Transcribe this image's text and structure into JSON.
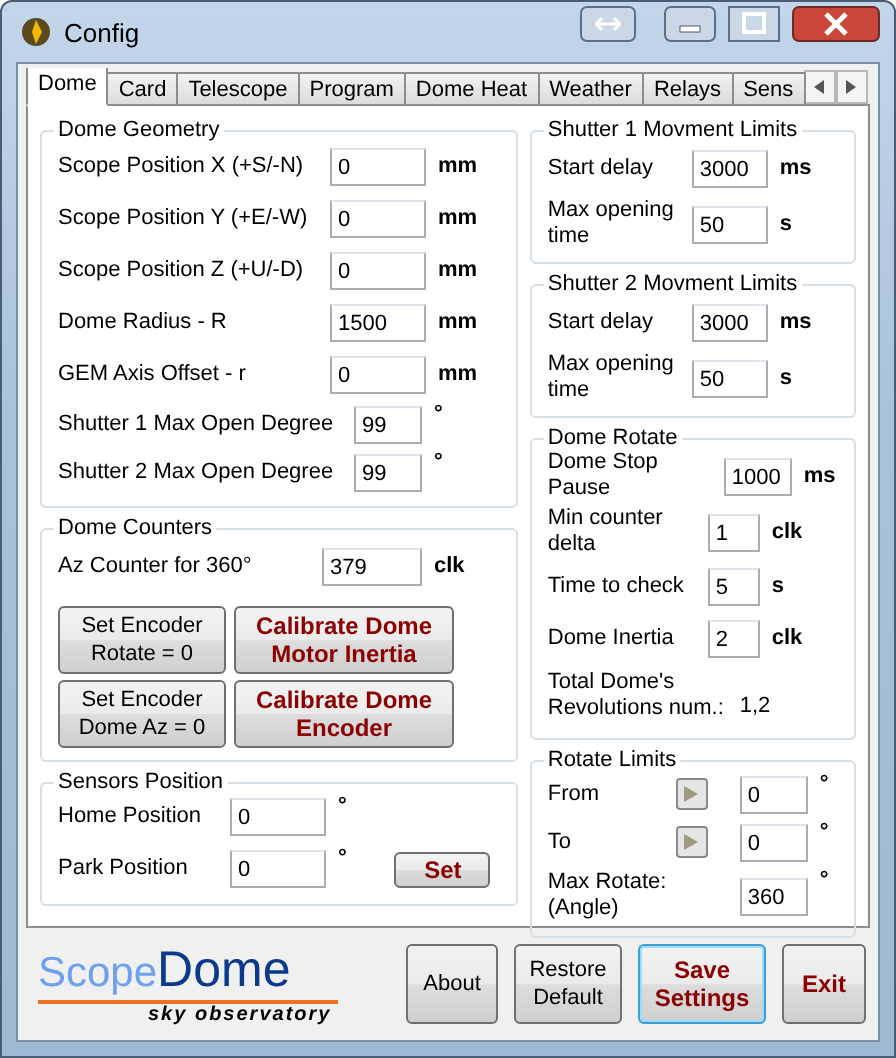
{
  "window": {
    "title": "Config"
  },
  "tabs": [
    {
      "label": "Dome",
      "selected": true
    },
    {
      "label": "Card",
      "selected": false
    },
    {
      "label": "Telescope",
      "selected": false
    },
    {
      "label": "Program",
      "selected": false
    },
    {
      "label": "Dome Heat",
      "selected": false
    },
    {
      "label": "Weather",
      "selected": false
    },
    {
      "label": "Relays",
      "selected": false
    },
    {
      "label": "Sens",
      "selected": false
    }
  ],
  "dome_geometry": {
    "title": "Dome Geometry",
    "rows": [
      {
        "label": "Scope Position X (+S/-N)",
        "value": "0",
        "unit": "mm"
      },
      {
        "label": "Scope Position Y (+E/-W)",
        "value": "0",
        "unit": "mm"
      },
      {
        "label": "Scope Position Z (+U/-D)",
        "value": "0",
        "unit": "mm"
      },
      {
        "label": "Dome Radius - R",
        "value": "1500",
        "unit": "mm"
      },
      {
        "label": "GEM Axis Offset - r",
        "value": "0",
        "unit": "mm"
      },
      {
        "label": "Shutter 1 Max Open Degree",
        "value": "99",
        "unit": "°"
      },
      {
        "label": "Shutter 2 Max Open Degree",
        "value": "99",
        "unit": "°"
      }
    ]
  },
  "dome_counters": {
    "title": "Dome Counters",
    "rows": [
      {
        "label": "Az Counter for 360°",
        "value": "379",
        "unit": "clk"
      }
    ],
    "buttons": [
      {
        "label": "Set Encoder Rotate = 0",
        "kind": "plain"
      },
      {
        "label": "Calibrate Dome Motor Inertia",
        "kind": "accent"
      },
      {
        "label": "Set Encoder Dome Az = 0",
        "kind": "plain"
      },
      {
        "label": "Calibrate Dome Encoder",
        "kind": "accent"
      }
    ]
  },
  "sensors_position": {
    "title": "Sensors Position",
    "rows": [
      {
        "label": "Home Position",
        "value": "0",
        "unit": "°"
      },
      {
        "label": "Park Position",
        "value": "0",
        "unit": "°"
      }
    ],
    "button": "Set"
  },
  "shutter_1": {
    "title": "Shutter 1 Movment Limits",
    "rows": [
      {
        "label": "Start delay",
        "value": "3000",
        "unit": "ms"
      },
      {
        "label": "Max  opening time",
        "value": "50",
        "unit": "s"
      }
    ]
  },
  "shutter_2": {
    "title": "Shutter 2 Movment Limits",
    "rows": [
      {
        "label": "Start delay",
        "value": "3000",
        "unit": "ms"
      },
      {
        "label": "Max  opening time",
        "value": "50",
        "unit": "s"
      }
    ]
  },
  "dome_rotate": {
    "title": "Dome Rotate",
    "rows": [
      {
        "label": "Dome Stop Pause",
        "value": "1000",
        "unit": "ms"
      },
      {
        "label": "Min counter delta",
        "value": "1",
        "unit": "clk"
      },
      {
        "label": "Time to check",
        "value": "5",
        "unit": "s"
      },
      {
        "label": "Dome Inertia",
        "value": "2",
        "unit": "clk"
      }
    ],
    "total_label": "Total Dome's Revolutions num.:",
    "total_value": "1,2"
  },
  "rotate_limits": {
    "title": "Rotate Limits",
    "rows": [
      {
        "label": "From",
        "kind": "arrow",
        "value": "0",
        "unit": "°"
      },
      {
        "label": "To",
        "kind": "arrow",
        "value": "0",
        "unit": "°"
      },
      {
        "label": "Max Rotate: (Angle)",
        "kind": "plain",
        "value": "360",
        "unit": "°"
      }
    ]
  },
  "logo": {
    "first": "Scope",
    "second": "Dome",
    "tagline": "sky observatory"
  },
  "footer_buttons": [
    {
      "label": "About",
      "kind": "plain",
      "focused": false
    },
    {
      "label": "Restore Default",
      "kind": "plain",
      "focused": false
    },
    {
      "label": "Save Settings",
      "kind": "accent",
      "focused": true
    },
    {
      "label": "Exit",
      "kind": "accent",
      "focused": false
    }
  ]
}
